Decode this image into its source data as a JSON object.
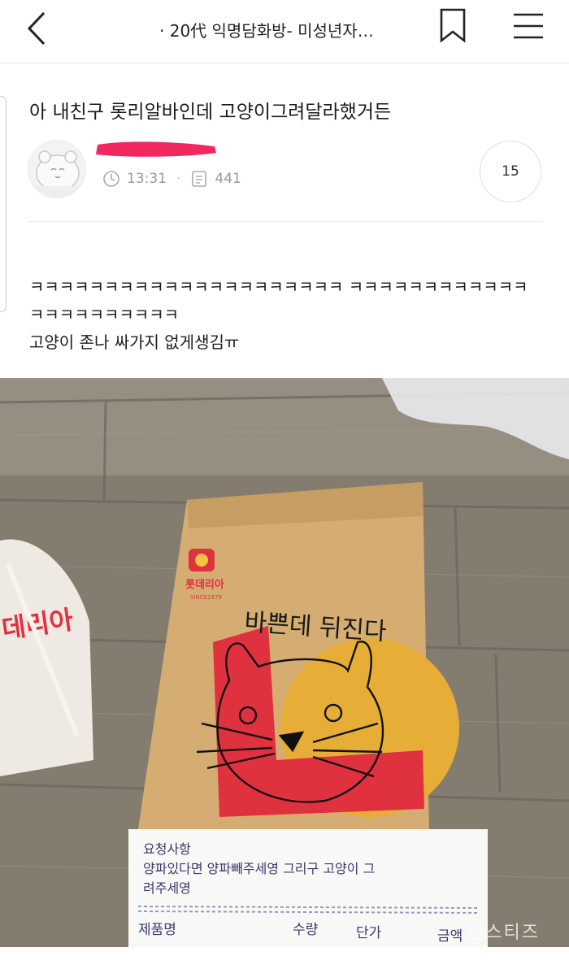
{
  "header": {
    "title": "· 20代 익명담화방- 미성년자…",
    "back_icon": "chevron-left-icon",
    "bookmark_icon": "bookmark-icon",
    "menu_icon": "hamburger-menu-icon"
  },
  "post": {
    "title": "아 내친구 롯리알바인데 고양이그려달라했거든",
    "time": "13:31",
    "views": "441",
    "comment_count": "15",
    "body_lines": [
      "ㅋㅋㅋㅋㅋㅋㅋㅋㅋㅋㅋㅋㅋㅋㅋㅋㅋㅋㅋㅋㅋ ㅋㅋㅋㅋㅋㅋㅋㅋㅋㅋㅋㅋ",
      "ㅋㅋㅋㅋㅋㅋㅋㅋㅋㅋ",
      "고양이 존나 싸가지 없게생김ㅠ"
    ]
  },
  "photo": {
    "bag_logo_text": "롯데리아",
    "bag_logo_since": "SINCE1979",
    "handwritten_text": "바쁜데 뒤진다",
    "receipt": {
      "heading": "요청사항",
      "line1": "양파있다면 양파빼주세영 그리구 고양이 그",
      "line2": "려주세영",
      "col_name": "제품명",
      "col_qty": "수량",
      "col_price": "단가",
      "col_amount": "금액"
    },
    "left_bag_text": "데리아",
    "watermark": "인스티즈"
  },
  "colors": {
    "accent_red": "#e0313f",
    "bag_kraft": "#d8b178",
    "bag_yellow": "#e8b23a",
    "floor": "#8a8174"
  }
}
